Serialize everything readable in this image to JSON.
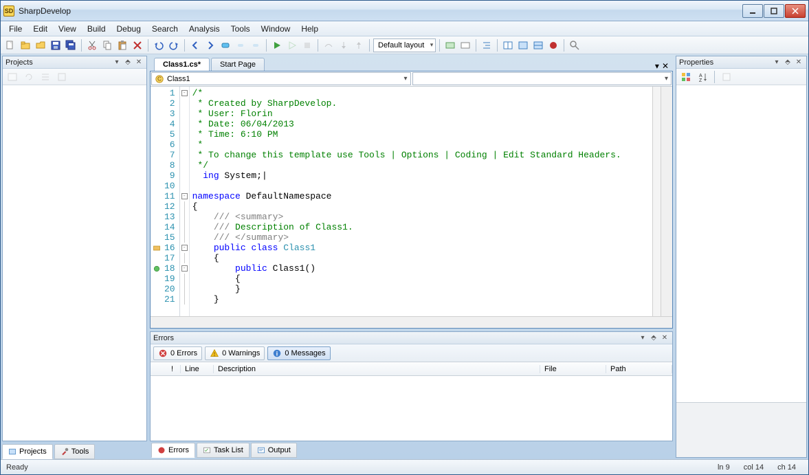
{
  "window": {
    "title": "SharpDevelop"
  },
  "menus": [
    "File",
    "Edit",
    "View",
    "Build",
    "Debug",
    "Search",
    "Analysis",
    "Tools",
    "Window",
    "Help"
  ],
  "toolbar": {
    "layout_label": "Default layout"
  },
  "left": {
    "title": "Projects",
    "tabs": {
      "projects": "Projects",
      "tools": "Tools"
    }
  },
  "center": {
    "tabs": {
      "file": "Class1.cs*",
      "start": "Start Page"
    },
    "combo1": "Class1",
    "combo2": "",
    "lines": [
      {
        "n": 1,
        "fold": "-",
        "cls": "c-comment",
        "text": "/*"
      },
      {
        "n": 2,
        "cls": "c-comment",
        "text": " * Created by SharpDevelop."
      },
      {
        "n": 3,
        "cls": "c-comment",
        "text": " * User: Florin"
      },
      {
        "n": 4,
        "cls": "c-comment",
        "text": " * Date: 06/04/2013"
      },
      {
        "n": 5,
        "cls": "c-comment",
        "text": " * Time: 6:10 PM"
      },
      {
        "n": 6,
        "cls": "c-comment",
        "text": " * "
      },
      {
        "n": 7,
        "cls": "c-comment",
        "text": " * To change this template use Tools | Options | Coding | Edit Standard Headers."
      },
      {
        "n": 8,
        "cls": "c-comment",
        "text": " */"
      },
      {
        "n": 9,
        "html": "  <span class='c-keyword'>ing</span> System;|"
      },
      {
        "n": 10,
        "text": ""
      },
      {
        "n": 11,
        "fold": "-",
        "html": "<span class='c-keyword'>namespace</span> DefaultNamespace"
      },
      {
        "n": 12,
        "text": "{"
      },
      {
        "n": 13,
        "html": "    <span class='c-docxml'>/// &lt;summary&gt;</span>"
      },
      {
        "n": 14,
        "html": "    <span class='c-docxml'>///</span> <span class='c-doctext'>Description of Class1.</span>"
      },
      {
        "n": 15,
        "html": "    <span class='c-docxml'>/// &lt;/summary&gt;</span>"
      },
      {
        "n": 16,
        "fold": "-",
        "marker": "class",
        "html": "    <span class='c-keyword'>public</span> <span class='c-keyword'>class</span> <span class='c-type'>Class1</span>"
      },
      {
        "n": 17,
        "text": "    {"
      },
      {
        "n": 18,
        "fold": "-",
        "marker": "method",
        "html": "        <span class='c-keyword'>public</span> Class1()"
      },
      {
        "n": 19,
        "text": "        {"
      },
      {
        "n": 20,
        "text": "        }"
      },
      {
        "n": 21,
        "text": "    }"
      }
    ]
  },
  "errors": {
    "title": "Errors",
    "filters": {
      "errors": "0 Errors",
      "warnings": "0 Warnings",
      "messages": "0 Messages"
    },
    "columns": {
      "bang": "!",
      "line": "Line",
      "desc": "Description",
      "file": "File",
      "path": "Path"
    },
    "bottom_tabs": {
      "errors": "Errors",
      "tasklist": "Task List",
      "output": "Output"
    }
  },
  "right": {
    "title": "Properties"
  },
  "status": {
    "ready": "Ready",
    "line": "ln 9",
    "col": "col 14",
    "ch": "ch 14"
  }
}
